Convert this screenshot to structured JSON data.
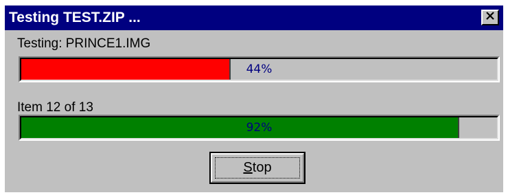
{
  "window": {
    "title": "Testing TEST.ZIP ...",
    "close_icon": "close-icon"
  },
  "file_progress": {
    "label": "Testing: PRINCE1.IMG",
    "percent": 44,
    "percent_text": "44%",
    "fill_color": "#ff0000"
  },
  "item_progress": {
    "label": "Item 12 of 13",
    "percent": 92,
    "percent_text": "92%",
    "fill_color": "#008000"
  },
  "stop_button": {
    "label_mnemonic": "S",
    "label_rest": "top"
  },
  "colors": {
    "titlebar": "#000080",
    "dialog_face": "#c0c0c0",
    "percent_text": "#000080"
  }
}
